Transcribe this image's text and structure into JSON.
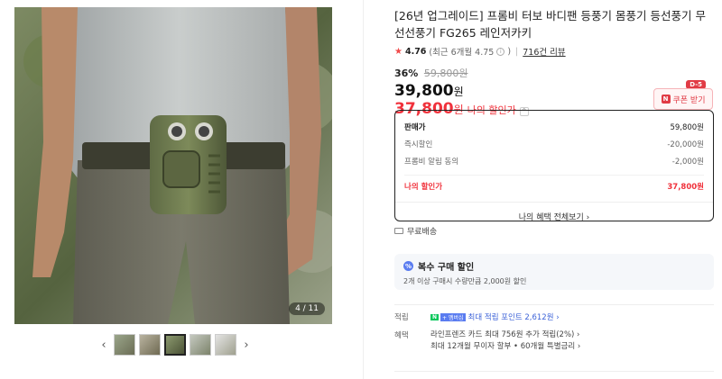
{
  "gallery": {
    "counter": "4 / 11",
    "prev_icon": "chevron-left-icon",
    "next_icon": "chevron-right-icon",
    "prev_glyph": "‹",
    "next_glyph": "›",
    "thumbnails": 5,
    "active_thumbnail": 3
  },
  "product": {
    "title": "[26년 업그레이드] 프롬비 터보 바디팬 등풍기 몸풍기 등선풍기 무선선풍기 FG265 레인저카키",
    "rating": "4.76",
    "rating_recent": "(최근 6개월 4.75",
    "rating_recent_close": ")",
    "review_count": "716건 리뷰"
  },
  "pricing": {
    "discount_rate": "36%",
    "original_price": "59,800원",
    "sale_price": "39,800",
    "won": "원",
    "my_price": "37,800",
    "my_price_label": "나의 할인가",
    "coupon_label": "쿠폰 받기",
    "coupon_badge": "N",
    "dday_badge": "D-5"
  },
  "price_box": {
    "rows": [
      {
        "label": "판매가",
        "value": "59,800원"
      },
      {
        "label": "즉시할인",
        "value": "-20,000원"
      },
      {
        "label": "프롬비 알림 동의",
        "value": "-2,000원"
      }
    ],
    "my_label": "나의 할인가",
    "my_value": "37,800원",
    "all_benefits": "나의 혜택 전체보기 ›"
  },
  "shipping": {
    "label": "무료배송"
  },
  "multi_buy": {
    "title": "복수 구매 할인",
    "icon": "%",
    "desc": "2개 이상 구매시 수량만큼 2,000원 할인"
  },
  "benefits": {
    "point_label": "적립",
    "npay_n": "N",
    "npay_plus": "+ 멤버십",
    "point_text": "최대 적립 포인트 2,612원 ›",
    "card_label": "혜택",
    "card_line1": "라인프렌즈 카드 최대 756원 추가 적립(2%) ›",
    "card_line2": "최대 12개월 무이자 할부 • 60개월 특별금리 ›"
  }
}
